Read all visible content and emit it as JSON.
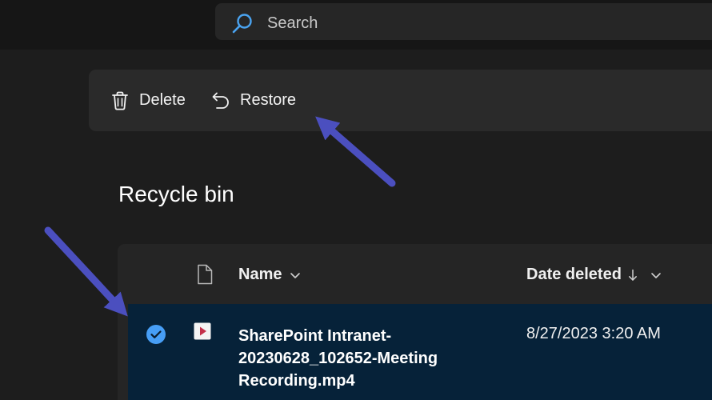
{
  "search": {
    "placeholder": "Search"
  },
  "toolbar": {
    "delete_label": "Delete",
    "restore_label": "Restore"
  },
  "page": {
    "title": "Recycle bin"
  },
  "list": {
    "columns": {
      "name": "Name",
      "date_deleted": "Date deleted"
    },
    "rows": [
      {
        "name": "SharePoint Intranet-20230628_102652-Meeting Recording.mp4",
        "date_deleted": "8/27/2023 3:20 AM",
        "selected": true,
        "icon": "video-file-icon"
      }
    ]
  },
  "colors": {
    "accent": "#479ef5",
    "selected_row": "#062239",
    "annotation_arrow": "#4b4fbf"
  }
}
